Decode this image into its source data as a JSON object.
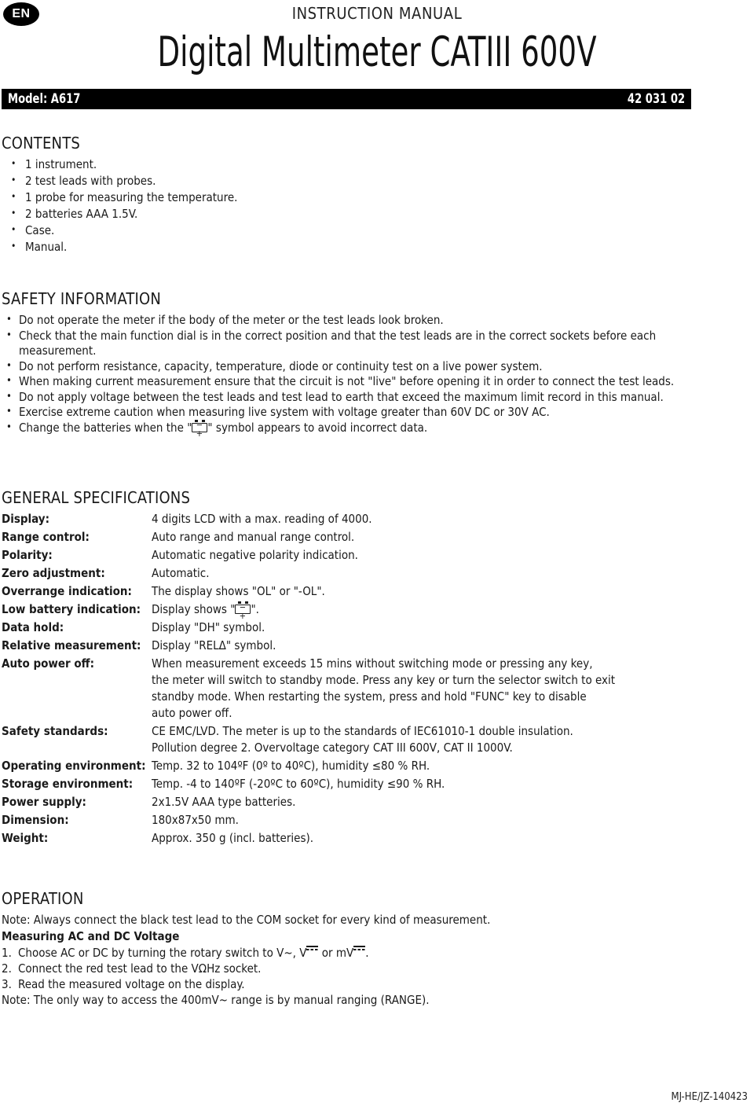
{
  "header": {
    "language_badge": "EN",
    "kicker": "INSTRUCTION MANUAL",
    "title": "Digital Multimeter CATIII 600V",
    "model_label": "Model: A617",
    "article_code": "42 031 02"
  },
  "contents": {
    "heading": "CONTENTS",
    "items": [
      "1 instrument.",
      "2 test leads with probes.",
      "1 probe for measuring the temperature.",
      "2 batteries AAA 1.5V.",
      "Case.",
      "Manual."
    ]
  },
  "safety": {
    "heading": "SAFETY INFORMATION",
    "items": [
      "Do not operate the meter if the body of the meter or the test leads look broken.",
      "Check that the main function dial is in the correct position and that the test leads are in the correct sockets before each measurement.",
      "Do not perform resistance, capacity, temperature, diode or continuity test on a live power system.",
      "When making current measurement ensure that the circuit is not \"live\" before opening it in order to connect the test leads.",
      "Do not apply voltage between the test leads and test lead to earth that exceed the maximum limit record in this manual.",
      "Exercise extreme caution when measuring live system with voltage greater than 60V DC or 30V AC."
    ],
    "battery_item_prefix": "Change the batteries when the \"",
    "battery_item_suffix": "\" symbol appears to avoid incorrect data."
  },
  "specs": {
    "heading": "GENERAL SPECIFICATIONS",
    "rows": [
      {
        "label": "Display:",
        "value": "4 digits LCD with a max. reading of 4000."
      },
      {
        "label": "Range control:",
        "value": "Auto range and manual range control."
      },
      {
        "label": "Polarity:",
        "value": "Automatic negative polarity indication."
      },
      {
        "label": "Zero adjustment:",
        "value": "Automatic."
      },
      {
        "label": "Overrange indication:",
        "value": "The display shows \"OL\" or \"-OL\"."
      },
      {
        "label": "Low battery indication:",
        "value_prefix": "Display shows \"",
        "value_suffix": "\"."
      },
      {
        "label": "Data hold:",
        "value": "Display \"DH\" symbol."
      },
      {
        "label": "Relative measurement:",
        "value": "Display \"RELΔ\" symbol."
      },
      {
        "label": "Auto power off:",
        "lines": [
          "When measurement exceeds 15 mins without switching mode or pressing any key,",
          "the meter will switch to standby mode. Press any key or turn the selector switch to exit",
          "standby mode. When restarting the system, press and hold \"FUNC\" key to disable",
          "auto power off."
        ]
      },
      {
        "label": "Safety standards:",
        "lines": [
          "CE EMC/LVD. The meter is up to the standards of IEC61010-1 double insulation.",
          "Pollution degree 2. Overvoltage category CAT III 600V, CAT II 1000V."
        ]
      },
      {
        "label": "Operating environment:",
        "value": "Temp. 32 to 104ºF (0º to 40ºC), humidity ≤80 % RH."
      },
      {
        "label": "Storage environment:",
        "value": "Temp. -4 to 140ºF (-20ºC to 60ºC), humidity ≤90 % RH."
      },
      {
        "label": "Power supply:",
        "value": "2x1.5V AAA type batteries."
      },
      {
        "label": "Dimension:",
        "value": "180x87x50 mm."
      },
      {
        "label": "Weight:",
        "value": "Approx. 350 g (incl. batteries)."
      }
    ]
  },
  "operation": {
    "heading": "OPERATION",
    "note_top": "Note: Always connect the black test lead to the COM socket for every kind of measurement.",
    "subheading": "Measuring AC and DC Voltage",
    "step1": {
      "num": "1.",
      "text_a": "Choose AC or DC by turning the rotary switch to V~, V",
      "text_b": " or mV",
      "text_c": "."
    },
    "step2": {
      "num": "2.",
      "text": "Connect the red test lead to the VΩHz socket."
    },
    "step3": {
      "num": "3.",
      "text": "Read the measured voltage on the display."
    },
    "note_bottom": "Note: The only way to access the 400mV~ range is by manual ranging (RANGE)."
  },
  "footer": {
    "code": "MJ-HE/JZ-140423"
  },
  "colors": {
    "ink": "#1a1a1a",
    "bar_background": "#000000",
    "bar_text": "#ffffff",
    "page_background": "#ffffff"
  }
}
